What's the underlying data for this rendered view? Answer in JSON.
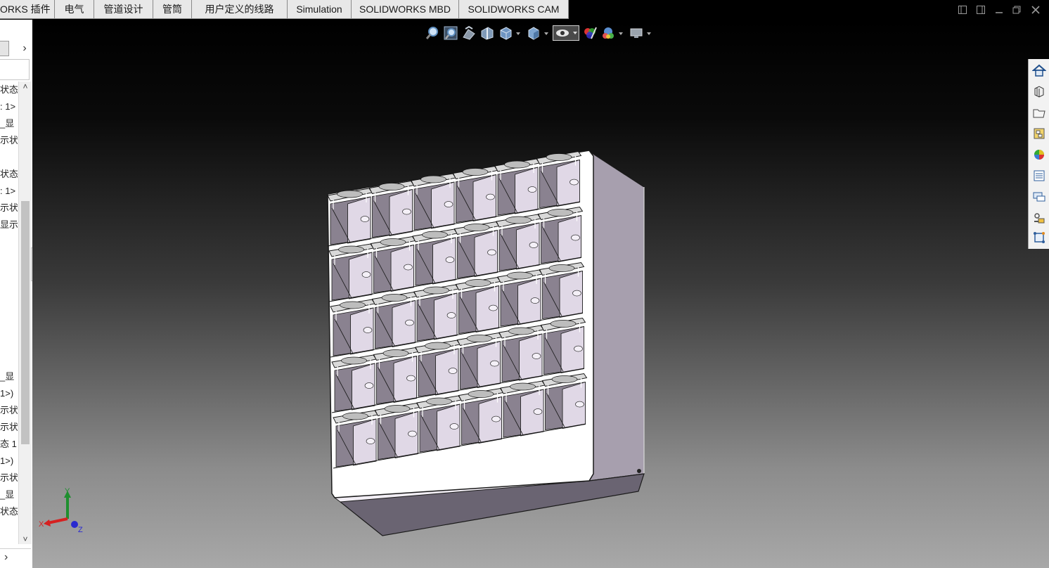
{
  "ribbon": {
    "tabs": [
      "ORKS 插件",
      "电气",
      "管道设计",
      "管筒",
      "用户定义的线路",
      "Simulation",
      "SOLIDWORKS MBD",
      "SOLIDWORKS CAM"
    ]
  },
  "left_panel": {
    "nav_arrow": "›",
    "tree_items": [
      "状态",
      ": 1>",
      "_显",
      "示状",
      "状态",
      ": 1>",
      "示状",
      "显示",
      "_显",
      "1>)",
      "示状",
      "示状",
      "态 1",
      "1>)",
      "示状",
      "_显",
      "状态"
    ],
    "scroll_up": "˄",
    "scroll_down": "˅",
    "bottom_arrow": "›"
  },
  "triad": {
    "x_label": "X",
    "y_label": "Y",
    "z_label": "Z"
  },
  "colors": {
    "ribbon_tab_bg": "#e8e8e8",
    "viewport_top": "#000000",
    "viewport_bottom": "#a8a8a8",
    "axis_x": "#d62020",
    "axis_y": "#1f8f2f",
    "axis_z": "#2a2acf",
    "model_side": "#a79fae",
    "model_panel": "#e0d8e6"
  },
  "icons": {
    "window_controls": [
      "split-vertical-icon",
      "split-horizontal-icon",
      "minimize-icon",
      "restore-icon",
      "close-icon"
    ],
    "heads_up_toolbar": [
      "zoom-to-fit-icon",
      "zoom-to-area-icon",
      "previous-view-icon",
      "section-view-icon",
      "view-orientation-icon",
      "display-style-icon",
      "hide-show-items-icon",
      "edit-appearance-icon",
      "apply-scene-icon",
      "view-settings-icon"
    ],
    "task_pane": [
      "home-icon",
      "solidworks-resources-icon",
      "design-library-icon",
      "file-explorer-icon",
      "appearances-icon",
      "custom-properties-icon",
      "forum-icon",
      "toolbox-icon",
      "3d-content-icon"
    ]
  }
}
